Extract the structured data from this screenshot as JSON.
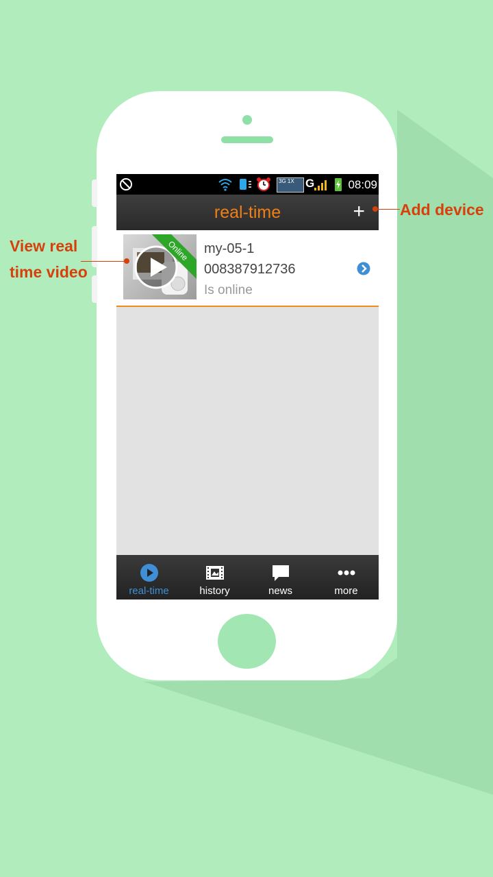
{
  "statusbar": {
    "time": "08:09",
    "network_badge": "3G 1X",
    "network_letter": "G"
  },
  "header": {
    "title": "real-time",
    "add_label": "+"
  },
  "device": {
    "name": "my-05-1",
    "id": "008387912736",
    "status": "Is online",
    "ribbon": "Online"
  },
  "tabs": [
    {
      "label": "real-time",
      "icon": "play-circle-icon",
      "active": true
    },
    {
      "label": "history",
      "icon": "film-icon",
      "active": false
    },
    {
      "label": "news",
      "icon": "chat-bubble-icon",
      "active": false
    },
    {
      "label": "more",
      "icon": "more-dots-icon",
      "active": false
    }
  ],
  "annotations": {
    "view_video_line1": "View real",
    "view_video_line2": "time video",
    "add_device": "Add device"
  },
  "colors": {
    "background": "#b0ecbc",
    "accent_orange": "#f07f16",
    "annotation_red": "#d6400d",
    "active_tab_blue": "#3f8fd6",
    "online_green": "#2ea628"
  }
}
